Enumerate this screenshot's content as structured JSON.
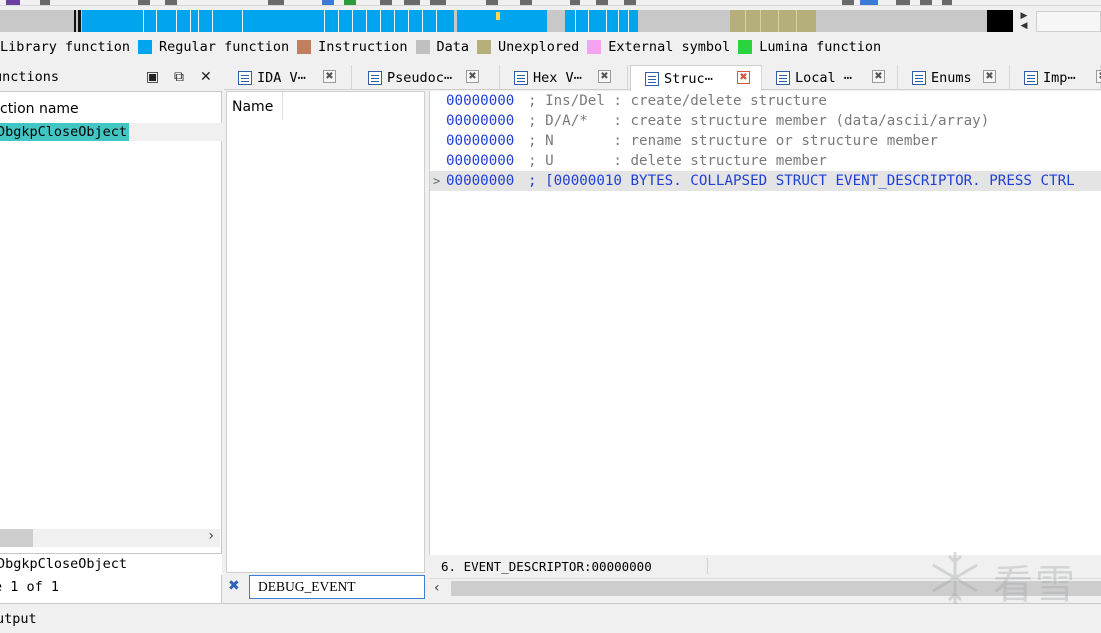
{
  "legend": [
    {
      "label": "Library function",
      "color": "#ffffff"
    },
    {
      "label": "Regular function",
      "color": "#00a5ed"
    },
    {
      "label": "Instruction",
      "color": "#c08060"
    },
    {
      "label": "Data",
      "color": "#c0c0c0"
    },
    {
      "label": "Unexplored",
      "color": "#b5b07a"
    },
    {
      "label": "External symbol",
      "color": "#f5a3f0"
    },
    {
      "label": "Lumina function",
      "color": "#2bd33e"
    }
  ],
  "functions_panel": {
    "title": "unctions",
    "column_header": "ction name",
    "selected_row": "DbgkpCloseObject",
    "bottom_name": "DbgkpCloseObject",
    "line_status": "e 1 of 1"
  },
  "tabs": [
    {
      "label": "IDA V⋯",
      "close": "✖",
      "active": false
    },
    {
      "label": "Pseudoc⋯",
      "close": "✖",
      "active": false
    },
    {
      "label": "Hex V⋯",
      "close": "✖",
      "active": false
    },
    {
      "label": "Struc⋯",
      "close": "✖",
      "active": true
    },
    {
      "label": "Local  ⋯",
      "close": "✖",
      "active": false
    },
    {
      "label": "Enums",
      "close": "✖",
      "active": false
    },
    {
      "label": "Imp⋯",
      "close": "✖",
      "active": false
    }
  ],
  "names_panel": {
    "column_header": "Name",
    "filter_value": "DEBUG_EVENT"
  },
  "structures": {
    "lines": [
      {
        "addr": "00000000",
        "text": "; Ins/Del : create/delete structure",
        "highlight": false
      },
      {
        "addr": "00000000",
        "text": "; D/A/*   : create structure member (data/ascii/array)",
        "highlight": false
      },
      {
        "addr": "00000000",
        "text": "; N       : rename structure or structure member",
        "highlight": false
      },
      {
        "addr": "00000000",
        "text": "; U       : delete structure member",
        "highlight": false
      },
      {
        "addr": "00000000",
        "text": "; [00000010 BYTES. COLLAPSED STRUCT EVENT_DESCRIPTOR. PRESS CTRL",
        "highlight": true
      }
    ],
    "status": "6. EVENT_DESCRIPTOR:00000000"
  },
  "output_bar": {
    "label": "utput"
  },
  "watermark": {
    "text": "看雪"
  },
  "icons": {
    "panel_maximize": "maximize-icon",
    "panel_float": "float-icon",
    "panel_close": "close-icon",
    "filter_clear": "clear-filter-icon",
    "expand": "expand-arrow-icon"
  }
}
